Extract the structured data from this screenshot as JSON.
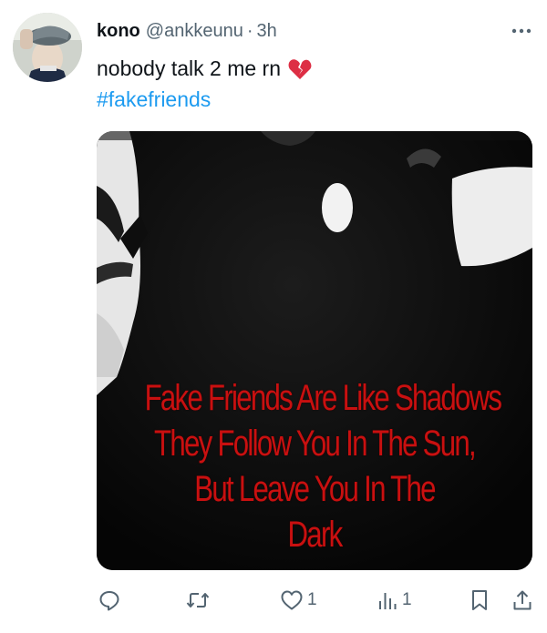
{
  "tweet": {
    "author_name": "kono",
    "handle": "@ankkeunu",
    "separator": "·",
    "time": "3h",
    "text": "nobody talk 2 me rn",
    "emoji_icon": "broken-heart-icon",
    "hashtag": "#fakefriends"
  },
  "media": {
    "lines": [
      "Fake Friends Are Like Shadows",
      "They Follow You In The Sun,",
      "But Leave You In The",
      "Dark"
    ]
  },
  "actions": {
    "reply_count": "",
    "retweet_count": "",
    "like_count": "1",
    "views_count": "1"
  },
  "colors": {
    "accent": "#1d9bf0",
    "secondary_text": "#536471",
    "caption_red": "#c91010"
  }
}
